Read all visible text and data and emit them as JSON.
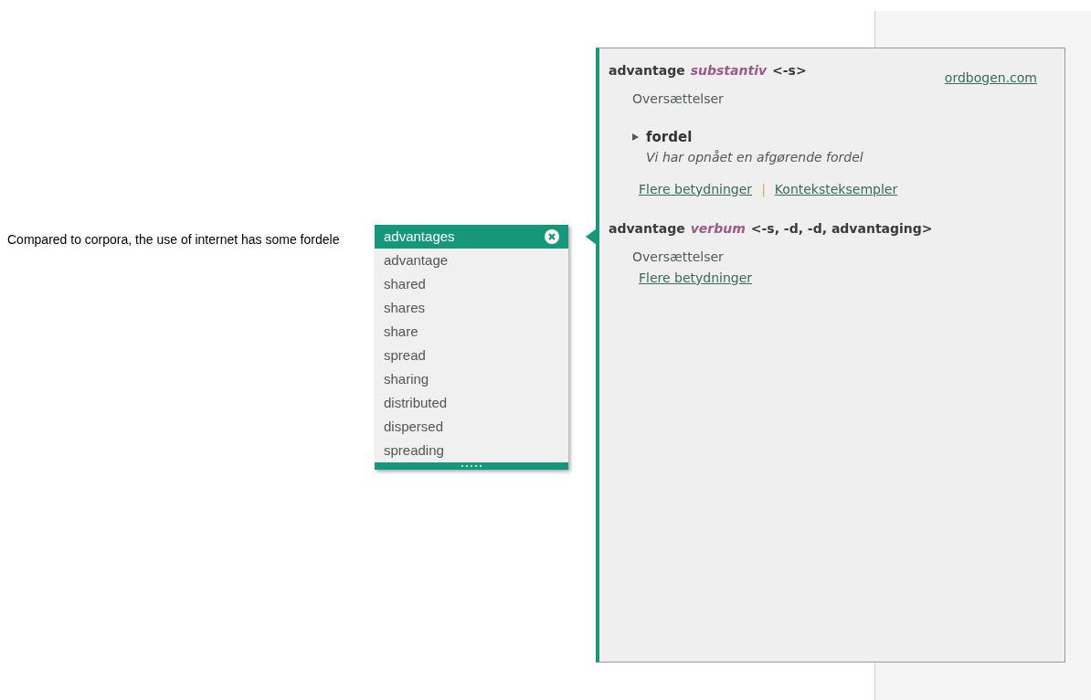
{
  "sentence": "Compared to corpora, the use of internet has some fordele",
  "suggestions": [
    {
      "text": "advantages",
      "selected": true
    },
    {
      "text": "advantage",
      "selected": false
    },
    {
      "text": "shared",
      "selected": false
    },
    {
      "text": "shares",
      "selected": false
    },
    {
      "text": "share",
      "selected": false
    },
    {
      "text": "spread",
      "selected": false
    },
    {
      "text": "sharing",
      "selected": false
    },
    {
      "text": "distributed",
      "selected": false
    },
    {
      "text": "dispersed",
      "selected": false
    },
    {
      "text": "spreading",
      "selected": false
    }
  ],
  "dictionary": {
    "source_link": "ordbogen.com",
    "entries": [
      {
        "headword": "advantage",
        "pos": "substantiv",
        "forms": "<-s>",
        "heading": "Oversættelser",
        "translations": [
          {
            "word": "fordel",
            "example": "Vi har opnået en afgørende fordel"
          }
        ],
        "links": [
          "Flere betydninger",
          "Konteksteksempler"
        ],
        "link_separator": "|"
      },
      {
        "headword": "advantage",
        "pos": "verbum",
        "forms": "<-s, -d, -d, advantaging>",
        "heading": "Oversættelser",
        "links": [
          "Flere betydninger"
        ]
      }
    ]
  }
}
